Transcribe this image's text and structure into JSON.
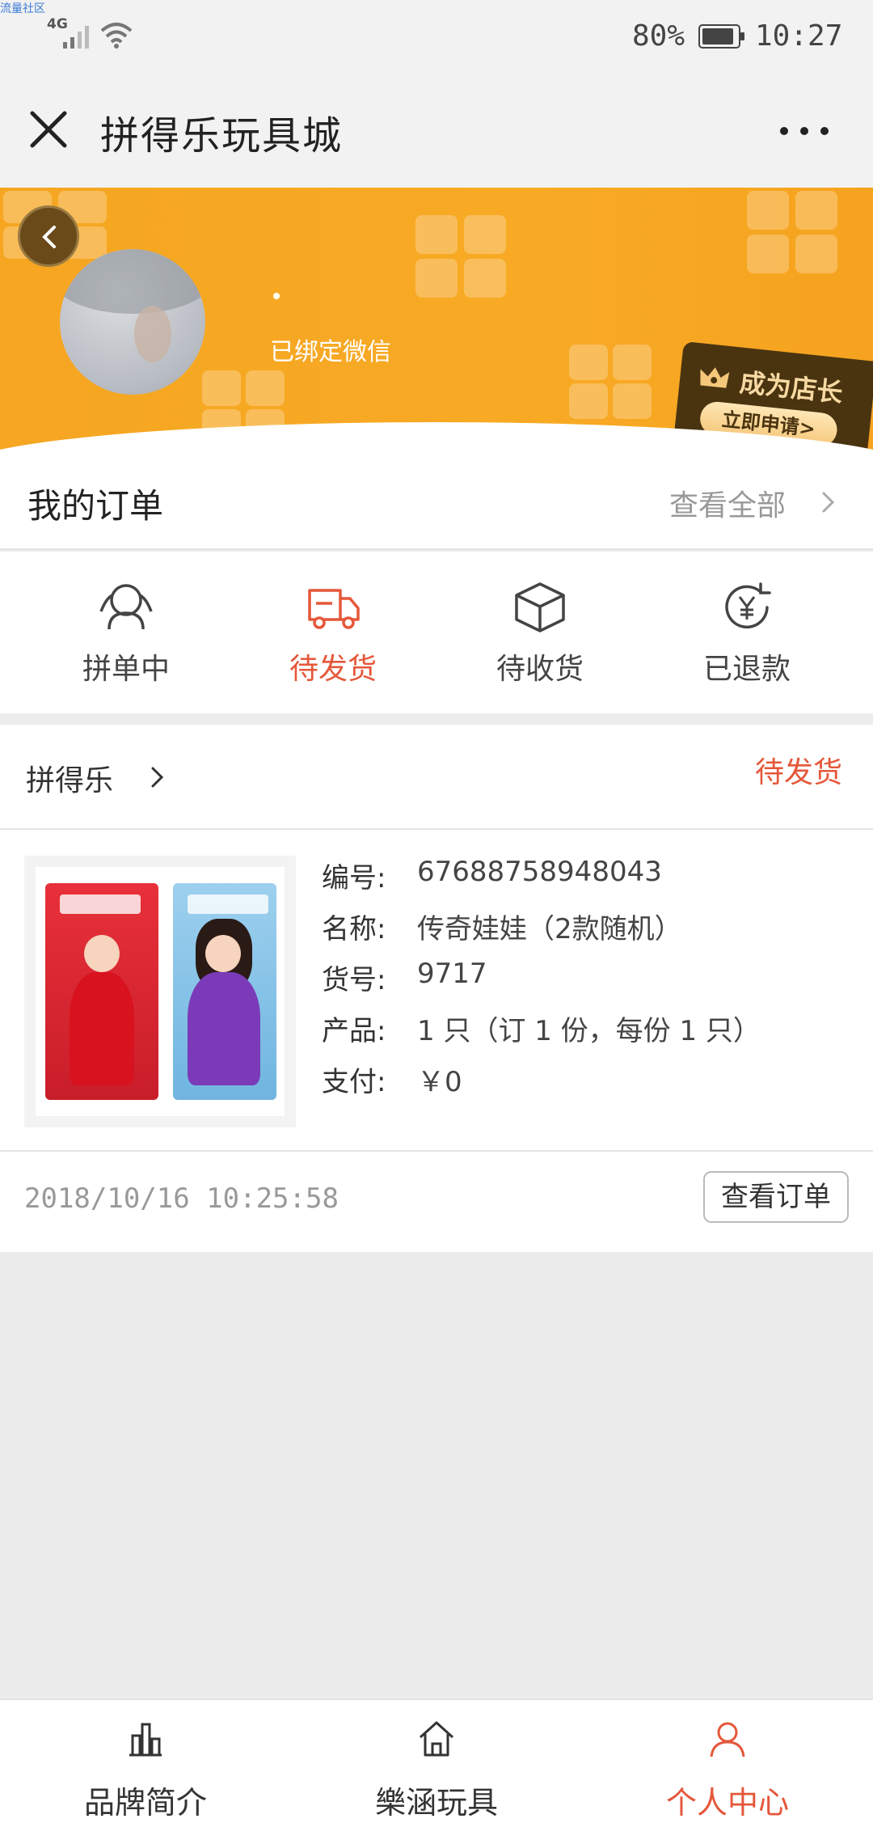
{
  "status_bar": {
    "corner_tag": "流量社区",
    "network": "4G",
    "battery": "80%",
    "time": "10:27"
  },
  "title_bar": {
    "title": "拼得乐玩具城"
  },
  "profile": {
    "bound_status": "已绑定微信",
    "shop_badge_title": "成为店长",
    "shop_badge_apply": "立即申请>"
  },
  "orders": {
    "title": "我的订单",
    "view_all": "查看全部",
    "statuses": [
      {
        "label": "拼单中",
        "icon": "group-icon"
      },
      {
        "label": "待发货",
        "icon": "truck-icon",
        "active": true
      },
      {
        "label": "待收货",
        "icon": "box-icon"
      },
      {
        "label": "已退款",
        "icon": "refund-icon"
      }
    ]
  },
  "order_card": {
    "shop_name": "拼得乐",
    "state": "待发货",
    "info": [
      {
        "key": "编号:",
        "value": "67688758948043"
      },
      {
        "key": "名称:",
        "value": "传奇娃娃（2款随机）"
      },
      {
        "key": "货号:",
        "value": "9717"
      },
      {
        "key": "产品:",
        "value": "1 只（订 1 份，每份 1 只）"
      },
      {
        "key": "支付:",
        "value": "￥0"
      }
    ],
    "time": "2018/10/16 10:25:58",
    "view_order": "查看订单"
  },
  "bottom_nav": [
    {
      "label": "品牌简介",
      "icon": "chart-icon"
    },
    {
      "label": "樂涵玩具",
      "icon": "home-icon"
    },
    {
      "label": "个人中心",
      "icon": "user-icon",
      "active": true
    }
  ],
  "colors": {
    "accent": "#e5573a",
    "banner": "#f7a823",
    "background": "#ececec"
  }
}
